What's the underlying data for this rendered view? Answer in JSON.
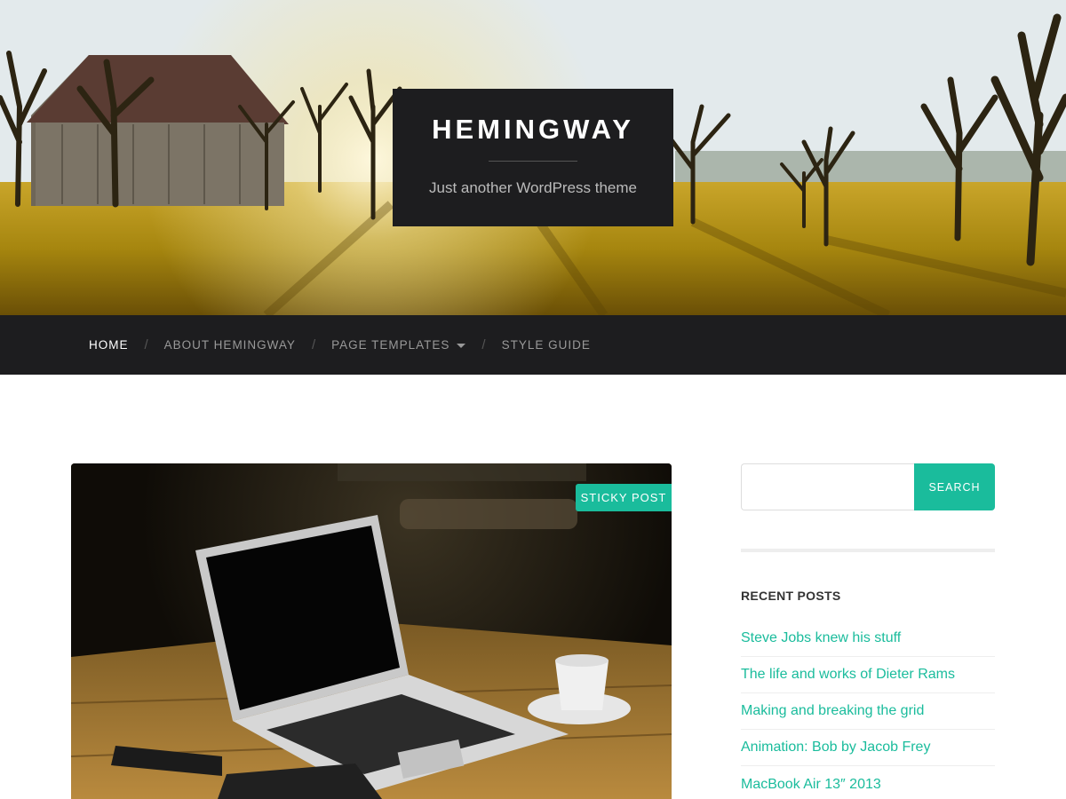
{
  "header": {
    "site_title": "HEMINGWAY",
    "site_description": "Just another WordPress theme"
  },
  "nav": {
    "items": [
      {
        "label": "HOME",
        "active": true
      },
      {
        "label": "ABOUT HEMINGWAY",
        "active": false
      },
      {
        "label": "PAGE TEMPLATES",
        "active": false,
        "has_dropdown": true
      },
      {
        "label": "STYLE GUIDE",
        "active": false
      }
    ],
    "separator": "/"
  },
  "post": {
    "badge": "STICKY POST"
  },
  "sidebar": {
    "search": {
      "value": "",
      "placeholder": "",
      "button_label": "SEARCH"
    },
    "recent_posts": {
      "title": "RECENT POSTS",
      "items": [
        "Steve Jobs knew his stuff",
        "The life and works of Dieter Rams",
        "Making and breaking the grid",
        "Animation: Bob by Jacob Frey",
        "MacBook Air 13″ 2013"
      ]
    }
  },
  "colors": {
    "accent": "#1abc9c",
    "dark": "#1d1d1f"
  }
}
